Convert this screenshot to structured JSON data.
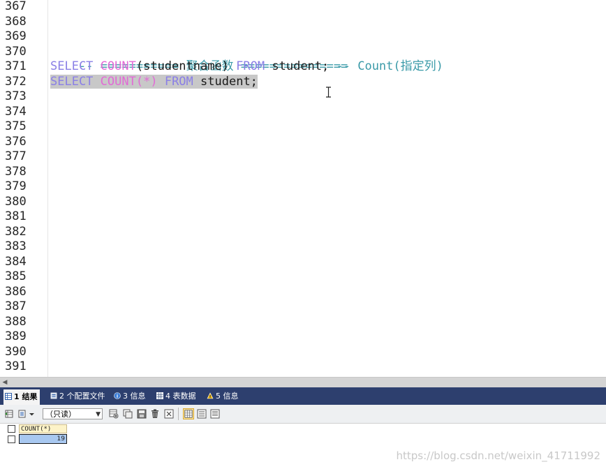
{
  "editor": {
    "line_numbers": [
      "367",
      "368",
      "369",
      "370",
      "371",
      "372",
      "373",
      "374",
      "375",
      "376",
      "377",
      "378",
      "379",
      "380",
      "381",
      "382",
      "383",
      "384",
      "385",
      "386",
      "387",
      "388",
      "389",
      "390",
      "391"
    ],
    "line_370": {
      "comment": "-- =========== 聚合函数 ==============="
    },
    "line_371": {
      "kw1": "SELECT",
      "fn1": "COUNT",
      "args": "(studentname)",
      "kw2": "FROM",
      "table": "student;",
      "comment": "-- Count(指定列)"
    },
    "line_372": {
      "kw1": "SELECT",
      "fn1": "COUNT",
      "args": "(*)",
      "kw2": "FROM",
      "table": "student;"
    }
  },
  "results": {
    "tabs": [
      {
        "label": "1 结果",
        "icon": "grid-table-icon",
        "active": true
      },
      {
        "label": "2 个配置文件",
        "icon": "profile-icon",
        "active": false
      },
      {
        "label": "3 信息",
        "icon": "info-icon",
        "active": false
      },
      {
        "label": "4 表数据",
        "icon": "table-data-icon",
        "active": false
      },
      {
        "label": "5 信息",
        "icon": "info-flag-icon",
        "active": false
      }
    ],
    "toolbar": {
      "readonly_value": "（只读）"
    },
    "grid": {
      "column_header": "COUNT(*)",
      "cell_value": "19"
    }
  },
  "watermark": "https://blog.csdn.net/weixin_41711992",
  "colors": {
    "keyword": "#8a7fe6",
    "function": "#e26ad6",
    "comment": "#3a9aa8",
    "selection": "#c8c8c8",
    "tab_bar": "#2d3f6e"
  }
}
